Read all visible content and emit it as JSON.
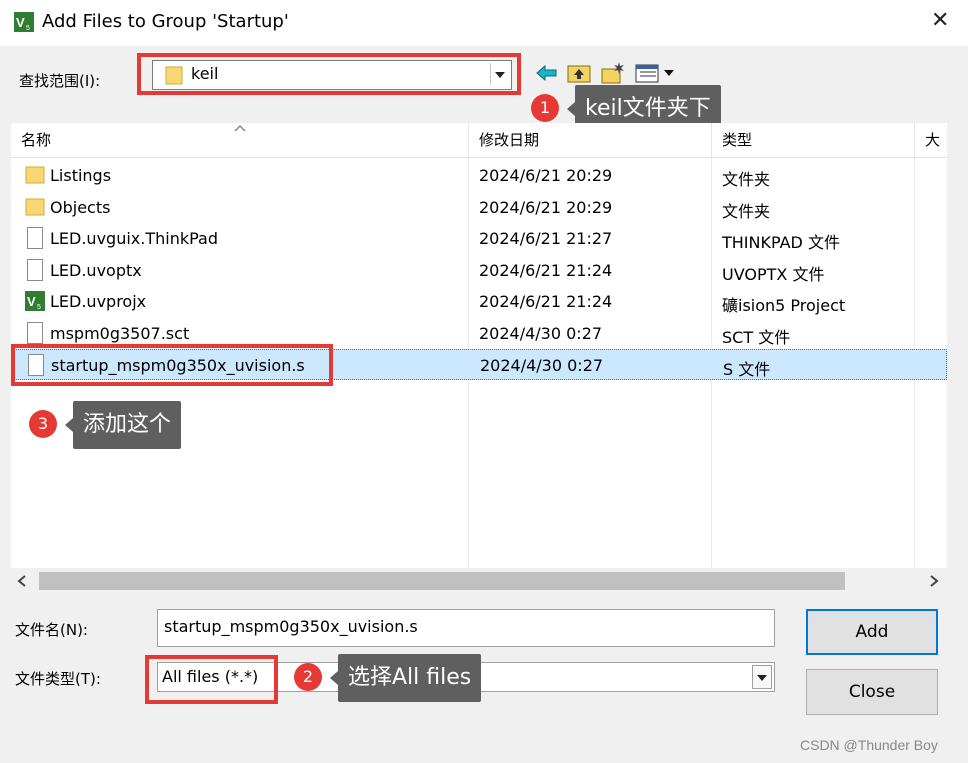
{
  "window": {
    "title": "Add Files to Group 'Startup'",
    "close_glyph": "✕"
  },
  "lookin": {
    "label": "查找范围(I):",
    "value": "keil"
  },
  "toolbar": {
    "icons": [
      "back-arrow-icon",
      "up-folder-icon",
      "new-folder-icon",
      "view-menu-icon"
    ]
  },
  "columns": [
    "名称",
    "修改日期",
    "类型",
    "大小"
  ],
  "files": [
    {
      "name": "Listings",
      "date": "2024/6/21 20:29",
      "type": "文件夹",
      "icon": "folder-icon",
      "selected": false
    },
    {
      "name": "Objects",
      "date": "2024/6/21 20:29",
      "type": "文件夹",
      "icon": "folder-icon",
      "selected": false
    },
    {
      "name": "LED.uvguix.ThinkPad",
      "date": "2024/6/21 21:27",
      "type": "THINKPAD 文件",
      "icon": "document-icon",
      "selected": false
    },
    {
      "name": "LED.uvoptx",
      "date": "2024/6/21 21:24",
      "type": "UVOPTX 文件",
      "icon": "document-icon",
      "selected": false
    },
    {
      "name": "LED.uvprojx",
      "date": "2024/6/21 21:24",
      "type": "礦ision5 Project",
      "icon": "uvision-project-icon",
      "selected": false
    },
    {
      "name": "mspm0g3507.sct",
      "date": "2024/4/30 0:27",
      "type": "SCT 文件",
      "icon": "document-icon",
      "selected": false
    },
    {
      "name": "startup_mspm0g350x_uvision.s",
      "date": "2024/4/30 0:27",
      "type": "S 文件",
      "icon": "document-icon",
      "selected": true
    }
  ],
  "filename": {
    "label": "文件名(N):",
    "value": "startup_mspm0g350x_uvision.s"
  },
  "filetype": {
    "label": "文件类型(T):",
    "value": "All files (*.*)"
  },
  "buttons": {
    "add": "Add",
    "close": "Close"
  },
  "annotations": [
    {
      "number": "1",
      "text": "keil文件夹下"
    },
    {
      "number": "2",
      "text": "选择All files"
    },
    {
      "number": "3",
      "text": "添加这个"
    }
  ],
  "watermark": "CSDN @Thunder Boy",
  "colors": {
    "annotation_red": "#e53935",
    "selection": "#cce8ff",
    "tooltip": "#5f5f5f"
  }
}
